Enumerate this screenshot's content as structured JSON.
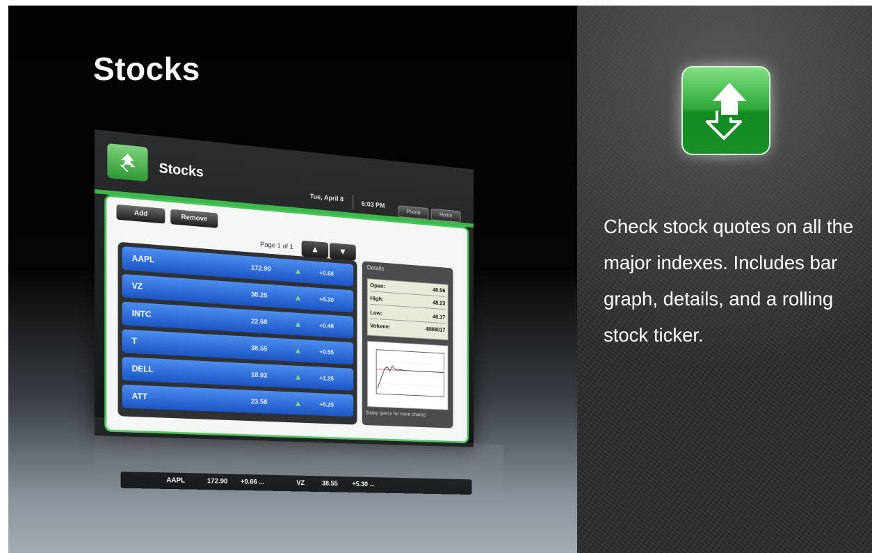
{
  "feature": {
    "title": "Stocks",
    "description": "Check stock quotes on all the major indexes. Includes bar graph, details, and a rolling stock ticker."
  },
  "app": {
    "title": "Stocks",
    "date": "Tue, April 8",
    "time": "6:03 PM",
    "phone_label": "Phone",
    "home_label": "Home",
    "add_label": "Add",
    "remove_label": "Remove",
    "page_label": "Page 1 of 1",
    "page_up": "▲",
    "page_down": "▼",
    "stocks": [
      {
        "symbol": "AAPL",
        "price": "172.90",
        "change": "+0.66"
      },
      {
        "symbol": "VZ",
        "price": "38.25",
        "change": "+5.30"
      },
      {
        "symbol": "INTC",
        "price": "22.68",
        "change": "+0.48"
      },
      {
        "symbol": "T",
        "price": "38.55",
        "change": "+0.55"
      },
      {
        "symbol": "DELL",
        "price": "18.92",
        "change": "+1.26"
      },
      {
        "symbol": "ATT",
        "price": "23.56",
        "change": "+5.25"
      }
    ],
    "details": {
      "title": "Details",
      "open_label": "Open:",
      "open_value": "46.56",
      "high_label": "High:",
      "high_value": "48.23",
      "low_label": "Low:",
      "low_value": "46.17",
      "volume_label": "Volume:",
      "volume_value": "4888017",
      "chart_caption": "Today (press for more charts)"
    },
    "ticker": [
      {
        "symbol": "AAPL",
        "price": "172.90",
        "change": "+0.66 ..."
      },
      {
        "symbol": "VZ",
        "price": "38.55",
        "change": "+5.30 ..."
      }
    ]
  },
  "colors": {
    "accent_green": "#3db84a",
    "row_blue": "#1c55c5",
    "up_arrow": "#7fd38a"
  },
  "icons": {
    "app_icon": "stock-up-down-arrows-icon",
    "row_arrow": "up-triangle-icon"
  }
}
